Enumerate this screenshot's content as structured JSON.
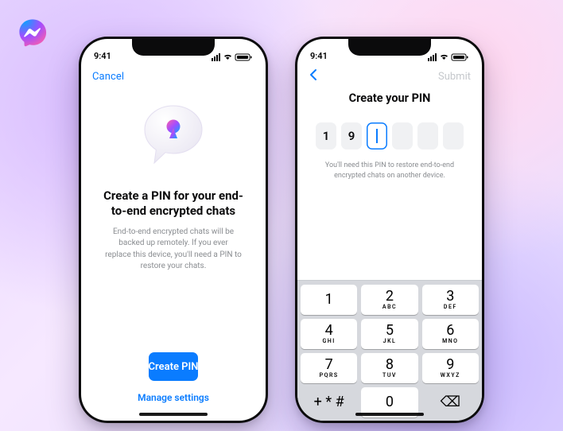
{
  "status": {
    "time": "9:41"
  },
  "phone1": {
    "nav": {
      "cancel": "Cancel"
    },
    "title": "Create a PIN for your end-to-end encrypted chats",
    "desc": "End-to-end encrypted chats will be backed up remotely. If you ever replace this device, you'll need a PIN to restore your chats.",
    "primary": "Create PIN",
    "secondary": "Manage settings"
  },
  "phone2": {
    "nav": {
      "submit": "Submit"
    },
    "title": "Create your PIN",
    "pin": [
      "1",
      "9",
      "",
      "",
      "",
      ""
    ],
    "active_index": 2,
    "hint": "You'll need this PIN to restore end-to-end encrypted chats on another device.",
    "keypad": {
      "rows": [
        [
          {
            "d": "1",
            "l": ""
          },
          {
            "d": "2",
            "l": "ABC"
          },
          {
            "d": "3",
            "l": "DEF"
          }
        ],
        [
          {
            "d": "4",
            "l": "GHI"
          },
          {
            "d": "5",
            "l": "JKL"
          },
          {
            "d": "6",
            "l": "MNO"
          }
        ],
        [
          {
            "d": "7",
            "l": "PQRS"
          },
          {
            "d": "8",
            "l": "TUV"
          },
          {
            "d": "9",
            "l": "WXYZ"
          }
        ],
        [
          {
            "d": "+ * #",
            "l": "",
            "util": true
          },
          {
            "d": "0",
            "l": ""
          },
          {
            "d": "⌫",
            "l": "",
            "util": true
          }
        ]
      ]
    }
  }
}
